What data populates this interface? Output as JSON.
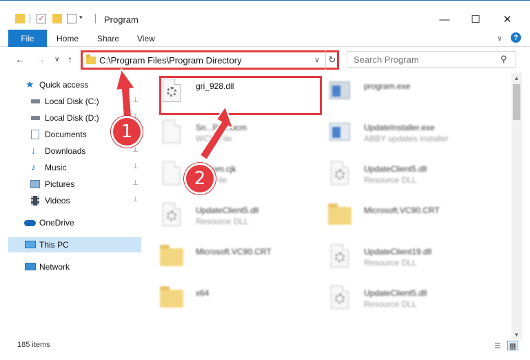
{
  "window": {
    "title": "Program",
    "controls": {
      "minimize": "—",
      "maximize": "☐",
      "close": "✕"
    }
  },
  "ribbon": {
    "tabs": [
      "File",
      "Home",
      "Share",
      "View"
    ],
    "chevron": "∨",
    "help": "?"
  },
  "navigation": {
    "back": "←",
    "forward": "→",
    "recent": "∨",
    "up": "↑",
    "address_path": "C:\\Program Files\\Program Directory",
    "address_dropdown": "∨",
    "refresh": "↻",
    "search_placeholder": "Search Program",
    "search_icon": "⚲"
  },
  "sidebar": {
    "items": [
      {
        "label": "Quick access",
        "icon": "star-icon",
        "pinned": false
      },
      {
        "label": "Local Disk (C:)",
        "icon": "drive-icon",
        "pinned": true
      },
      {
        "label": "Local Disk (D:)",
        "icon": "drive-icon",
        "pinned": true
      },
      {
        "label": "Documents",
        "icon": "documents-icon",
        "pinned": true
      },
      {
        "label": "Downloads",
        "icon": "download-icon",
        "pinned": true
      },
      {
        "label": "Music",
        "icon": "music-icon",
        "pinned": true
      },
      {
        "label": "Pictures",
        "icon": "pictures-icon",
        "pinned": true
      },
      {
        "label": "Videos",
        "icon": "videos-icon",
        "pinned": true
      },
      {
        "label": "OneDrive",
        "icon": "cloud-icon",
        "pinned": false
      },
      {
        "label": "This PC",
        "icon": "computer-icon",
        "pinned": false,
        "selected": true
      },
      {
        "label": "Network",
        "icon": "network-icon",
        "pinned": false
      }
    ],
    "pin_glyph": "📌"
  },
  "files": [
    {
      "name": "gri_928.dll",
      "type": "",
      "icon": "dll-icon",
      "highlighted": true
    },
    {
      "name": "program.exe",
      "type": "",
      "icon": "exe-icon",
      "blurred": true
    },
    {
      "name": "Sn...P15.wcm",
      "type": "WCM File",
      "icon": "blank-file-icon",
      "blurred": true
    },
    {
      "name": "UpdateInstaller.exe",
      "type": "ABBY updates installer",
      "icon": "exe-icon",
      "blurred": true
    },
    {
      "name": "F...Kom.cjk",
      "type": "CJK File",
      "icon": "blank-file-icon",
      "blurred": true
    },
    {
      "name": "UpdateClient5.dll",
      "type": "Resource DLL",
      "icon": "dll-icon",
      "blurred": true
    },
    {
      "name": "UpdateClient5.dll",
      "type": "Resource DLL",
      "icon": "dll-icon",
      "blurred": true
    },
    {
      "name": "Microsoft.VC90.CRT",
      "type": "",
      "icon": "folder-icon",
      "blurred": true
    },
    {
      "name": "Microsoft.VC90.CRT",
      "type": "",
      "icon": "folder-icon",
      "blurred": true
    },
    {
      "name": "UpdateClient19.dll",
      "type": "Resource DLL",
      "icon": "dll-icon",
      "blurred": true
    },
    {
      "name": "x64",
      "type": "",
      "icon": "folder-icon",
      "blurred": true
    },
    {
      "name": "UpdateClient5.dll",
      "type": "Resource DLL",
      "icon": "dll-icon",
      "blurred": true
    }
  ],
  "status": {
    "item_count": "185 items",
    "details_view": "☰",
    "icons_view": "▦"
  },
  "annotations": {
    "step1": "1",
    "step2": "2",
    "color": "#e53b40"
  }
}
